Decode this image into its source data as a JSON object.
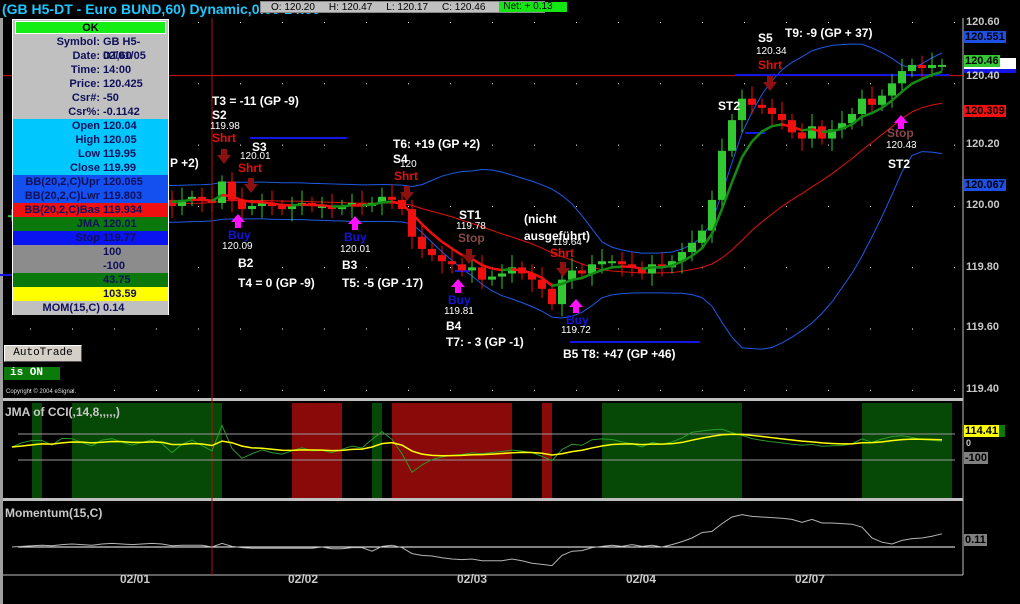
{
  "header": {
    "title": "(GB H5-DT - Euro BUND,60) Dynamic,0:00-24:00",
    "open": "O: 120.20",
    "high": "H: 120.47",
    "low": "L: 120.17",
    "close": "C: 120.46",
    "net": "Net: + 0.13"
  },
  "data_window": {
    "ok": "OK",
    "rows": [
      {
        "k": "Symbol:",
        "v": "GB H5-DT,60",
        "bg": "#c0c0c0"
      },
      {
        "k": "Date:",
        "v": "02/01/05",
        "bg": "#c0c0c0"
      },
      {
        "k": "Time:",
        "v": "14:00",
        "bg": "#c0c0c0"
      },
      {
        "k": "Price:",
        "v": "120.425",
        "bg": "#c0c0c0"
      },
      {
        "k": "Csr#:",
        "v": "-50",
        "bg": "#c0c0c0"
      },
      {
        "k": "Csr%:",
        "v": "-0.1142",
        "bg": "#c0c0c0"
      },
      {
        "k": "Open",
        "v": "120.04",
        "bg": "#00c8ff"
      },
      {
        "k": "High",
        "v": "120.05",
        "bg": "#00c8ff"
      },
      {
        "k": "Low",
        "v": "119.95",
        "bg": "#00c8ff"
      },
      {
        "k": "Close",
        "v": "119.99",
        "bg": "#00c8ff"
      },
      {
        "k": "BB(20,2,C)Upr",
        "v": "120.065",
        "bg": "#1450f0"
      },
      {
        "k": "BB(20,2,C)Lwr",
        "v": "119.803",
        "bg": "#1450f0"
      },
      {
        "k": "BB(20,2,C)Bas",
        "v": "119.934",
        "bg": "#f01010"
      },
      {
        "k": "JMA",
        "v": "120.01",
        "bg": "#0a780a"
      },
      {
        "k": "Stop",
        "v": "119.77",
        "bg": "#0a14f0"
      },
      {
        "k": "",
        "v": "100",
        "bg": "#8c8c8c"
      },
      {
        "k": "",
        "v": "-100",
        "bg": "#8c8c8c"
      },
      {
        "k": "",
        "v": "43.75",
        "bg": "#0a780a"
      },
      {
        "k": "",
        "v": "103.59",
        "bg": "#ffff00"
      },
      {
        "k": "MOM(15,C)",
        "v": "0.14",
        "bg": "#c0c0c0"
      }
    ]
  },
  "autotrade": {
    "button": "AutoTrade",
    "status": "is ON"
  },
  "copyright": "Copyright © 2004 eSignal.",
  "annotations": {
    "t3": "T3 = -11 (GP -9)",
    "s2": "S2",
    "s2p": "119.98",
    "s3": "S3",
    "s3p": "120.01",
    "gp2": "P +2)",
    "buy": "Buy",
    "shrt": "Shrt",
    "stop": "Stop",
    "b2p": "120.09",
    "b2": "B2",
    "t4": "T4 = 0 (GP -9)",
    "b3p": "120.01",
    "b3": "B3",
    "t5": "T5: -5 (GP -17)",
    "t6": "T6: +19 (GP +2)",
    "s4": "S4",
    "s4p": "120",
    "st1": "ST1",
    "st1p": "119.78",
    "nicht1": "(nicht",
    "nicht2": "ausgeführt)",
    "nichtp": "119.64",
    "b4p": "119.81",
    "b4": "B4",
    "t7": "T7: - 3 (GP -1)",
    "b5p": "119.72",
    "b5t8": "B5   T8: +47 (GP +46)",
    "s5": "S5",
    "s5p": "120.34",
    "t9": "T9: -9 (GP + 37)",
    "st2a": "ST2",
    "st2b": "ST2",
    "st2p": "120.43"
  },
  "axis": {
    "price_ticks": [
      "120.60",
      "120.40",
      "120.20",
      "120.00",
      "119.80",
      "119.60",
      "119.40"
    ],
    "bb_upper": "120.551",
    "last": "120.46",
    "stop": "120.4",
    "bb_basis": "120.309",
    "bb_lower": "120.067",
    "cci_value": "114.41",
    "cci_zero": "0",
    "cci_minus": "-100",
    "mom_value": "0.11"
  },
  "panes": {
    "cci_title": "JMA of CCI(,14,8,,,,,)",
    "mom_title": "Momentum(15,C)"
  },
  "dates": [
    "02/01",
    "02/02",
    "02/03",
    "02/04",
    "02/07"
  ],
  "colors": {
    "up": "#32c832",
    "down": "#f01010",
    "bb": "#1e5ae6",
    "basis": "#e01010",
    "jma": "#148c14"
  },
  "chart_data": {
    "type": "candlestick",
    "ylim": [
      119.36,
      120.62
    ],
    "closes": [
      119.97,
      119.98,
      119.99,
      120.0,
      119.99,
      120.01,
      120.02,
      120.01,
      120.0,
      120.02,
      120.03,
      120.02,
      120.01,
      120.02,
      120.03,
      120.02,
      120.0,
      120.02,
      120.03,
      120.02,
      120.01,
      120.08,
      120.02,
      119.99,
      120.0,
      120.01,
      120.0,
      119.99,
      120.0,
      120.01,
      120.0,
      120.0,
      119.99,
      120.0,
      120.01,
      120.0,
      120.01,
      120.03,
      120.02,
      119.99,
      119.9,
      119.86,
      119.84,
      119.82,
      119.81,
      119.79,
      119.8,
      119.76,
      119.77,
      119.78,
      119.8,
      119.78,
      119.76,
      119.73,
      119.68,
      119.76,
      119.79,
      119.78,
      119.81,
      119.82,
      119.82,
      119.81,
      119.8,
      119.78,
      119.81,
      119.8,
      119.82,
      119.85,
      119.88,
      119.92,
      120.02,
      120.18,
      120.28,
      120.35,
      120.33,
      120.32,
      120.3,
      120.28,
      120.24,
      120.22,
      120.26,
      120.22,
      120.25,
      120.27,
      120.3,
      120.35,
      120.33,
      120.36,
      120.4,
      120.44,
      120.46,
      120.45,
      120.46,
      120.46
    ],
    "cci_bands": [
      {
        "from": 2,
        "to": 3,
        "c": "g"
      },
      {
        "from": 6,
        "to": 21,
        "c": "g"
      },
      {
        "from": 28,
        "to": 33,
        "c": "r"
      },
      {
        "from": 36,
        "to": 37,
        "c": "r2"
      },
      {
        "from": 36,
        "to": 37,
        "c": "g"
      },
      {
        "from": 38,
        "to": 50,
        "c": "r"
      },
      {
        "from": 53,
        "to": 54,
        "c": "r"
      },
      {
        "from": 59,
        "to": 73,
        "c": "g"
      },
      {
        "from": 85,
        "to": 94,
        "c": "g"
      }
    ]
  }
}
